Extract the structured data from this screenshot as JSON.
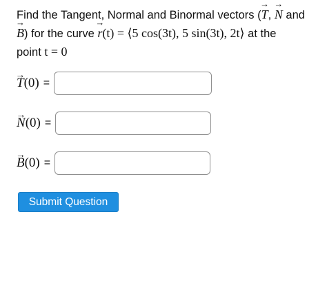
{
  "problem": {
    "text_1": "Find the Tangent, Normal and Binormal vectors (",
    "sym_T": "T",
    "sep_1": ", ",
    "sym_N": "N",
    "text_2": " and",
    "sym_B": "B",
    "text_3": ") for the curve ",
    "sym_r": "r",
    "curve_rest": "(t) = ⟨5 cos(3t), 5 sin(3t), 2t⟩",
    "text_4": " at the",
    "text_5": "point ",
    "point_eq": "t = 0"
  },
  "answers": [
    {
      "vec": "T",
      "arg": "(0)",
      "equals": "=",
      "value": ""
    },
    {
      "vec": "N",
      "arg": "(0)",
      "equals": "=",
      "value": ""
    },
    {
      "vec": "B",
      "arg": "(0)",
      "equals": "=",
      "value": ""
    }
  ],
  "submit_label": "Submit Question",
  "colors": {
    "submit_bg": "#1f8fe0",
    "box_border": "#8f8f8f"
  }
}
